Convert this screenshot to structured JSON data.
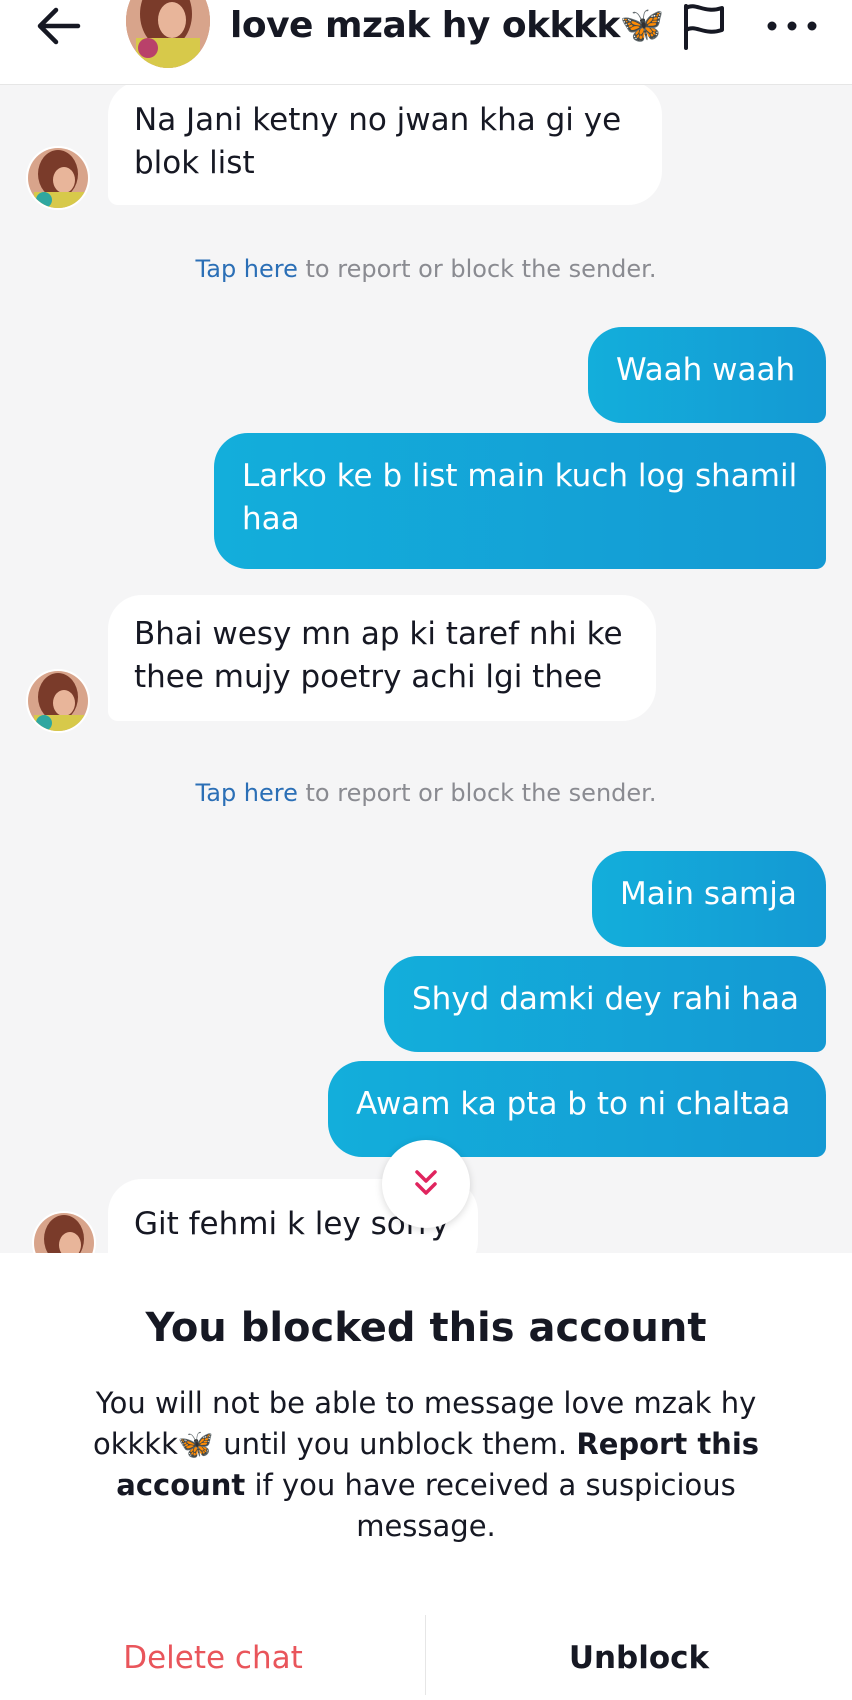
{
  "header": {
    "title": "love mzak hy okkkk🦋",
    "back_icon": "arrow-left-icon",
    "flag_icon": "flag-icon",
    "more_icon": "ellipsis-icon"
  },
  "messages": [
    {
      "from": "them",
      "text_lines": [
        "Na Jani ketny no jwan kha gi ye",
        "blok list"
      ]
    },
    {
      "from": "system",
      "link": "Tap here",
      "text": " to report or block the sender."
    },
    {
      "from": "me",
      "text_lines": [
        "Waah waah"
      ]
    },
    {
      "from": "me",
      "text_lines": [
        "Larko ke b list main kuch log shamil",
        "haa"
      ]
    },
    {
      "from": "them",
      "text_lines": [
        "Bhai wesy mn ap ki taref nhi ke",
        "thee mujy poetry achi lgi thee"
      ]
    },
    {
      "from": "system",
      "link": "Tap here",
      "text": " to report or block the sender."
    },
    {
      "from": "me",
      "text_lines": [
        "Main samja"
      ]
    },
    {
      "from": "me",
      "text_lines": [
        "Shyd damki dey rahi haa"
      ]
    },
    {
      "from": "me",
      "text_lines": [
        "Awam ka pta b to ni chaltaa"
      ]
    },
    {
      "from": "them",
      "text_lines": [
        "Git fehmi k ley sorry"
      ]
    }
  ],
  "scroll_down_icon": "double-chevron-down-icon",
  "blocked_panel": {
    "title": "You blocked this account",
    "body_part1": "You will not be able to message love mzak hy okkkk🦋 until you unblock them. ",
    "body_bold": "Report this account",
    "body_part2": " if you have received a suspicious message.",
    "delete_label": "Delete chat",
    "unblock_label": "Unblock"
  },
  "colors": {
    "outgoing_bubble": "#14a9d9",
    "incoming_bubble": "#ffffff",
    "link": "#2b6fb6",
    "delete": "#e9555b",
    "background": "#f5f5f6"
  }
}
